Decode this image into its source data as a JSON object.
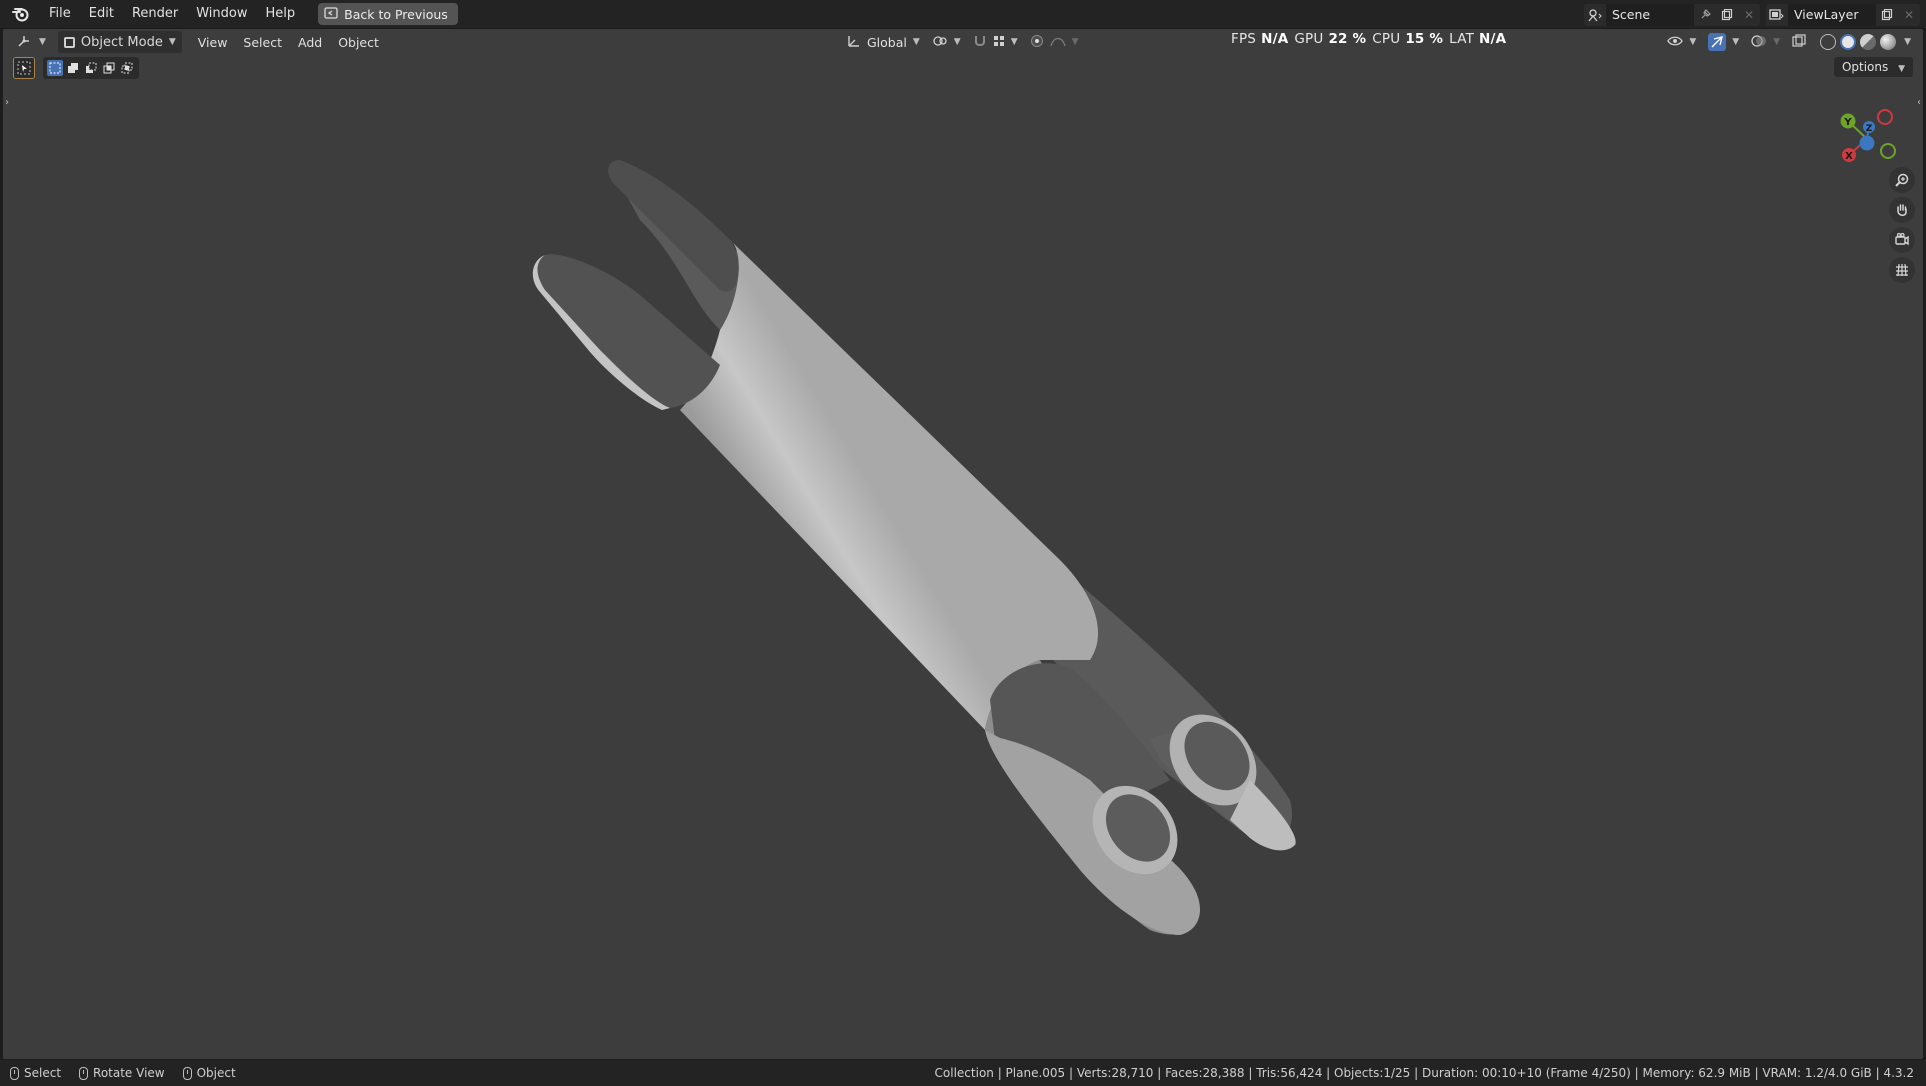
{
  "topbar": {
    "menus": [
      "File",
      "Edit",
      "Render",
      "Window",
      "Help"
    ],
    "back_button": "Back to Previous",
    "scene_label": "Scene",
    "view_layer_label": "ViewLayer"
  },
  "viewport_header": {
    "mode": "Object Mode",
    "menus": [
      "View",
      "Select",
      "Add",
      "Object"
    ],
    "transform_orientation": "Global",
    "options_label": "Options"
  },
  "stats": {
    "fps_label": "FPS",
    "fps_value": "N/A",
    "gpu_label": "GPU",
    "gpu_value": "22 %",
    "cpu_label": "CPU",
    "cpu_value": "15 %",
    "lat_label": "LAT",
    "lat_value": "N/A"
  },
  "gizmo": {
    "y_label": "Y",
    "z_label": "Z",
    "x_label": "X",
    "colors": {
      "x": "#d0393f",
      "y": "#6ea329",
      "z": "#3a78c2"
    }
  },
  "statusbar": {
    "items": [
      "Select",
      "Rotate View",
      "Object"
    ],
    "info": "Collection | Plane.005 | Verts:28,710 | Faces:28,388 | Tris:56,424 | Objects:1/25 | Duration: 00:10+10 (Frame 4/250) | Memory: 62.9 MiB | VRAM: 1.2/4.0 GiB | 4.3.2"
  },
  "icons": [
    "blender-logo-icon",
    "back-icon",
    "scene-icon",
    "pin-icon",
    "new-scene-icon",
    "close-icon",
    "view-layer-icon",
    "editor-type-icon",
    "object-mode-icon",
    "transform-orientation-icon",
    "pivot-icon",
    "snap-icon",
    "proportional-edit-icon",
    "visibility-icon",
    "gizmo-icon",
    "overlay-icon",
    "xray-icon",
    "wireframe-shading-icon",
    "solid-shading-icon",
    "material-shading-icon",
    "rendered-shading-icon",
    "zoom-icon",
    "pan-icon",
    "camera-view-icon",
    "ortho-grid-icon",
    "select-box-icon"
  ]
}
